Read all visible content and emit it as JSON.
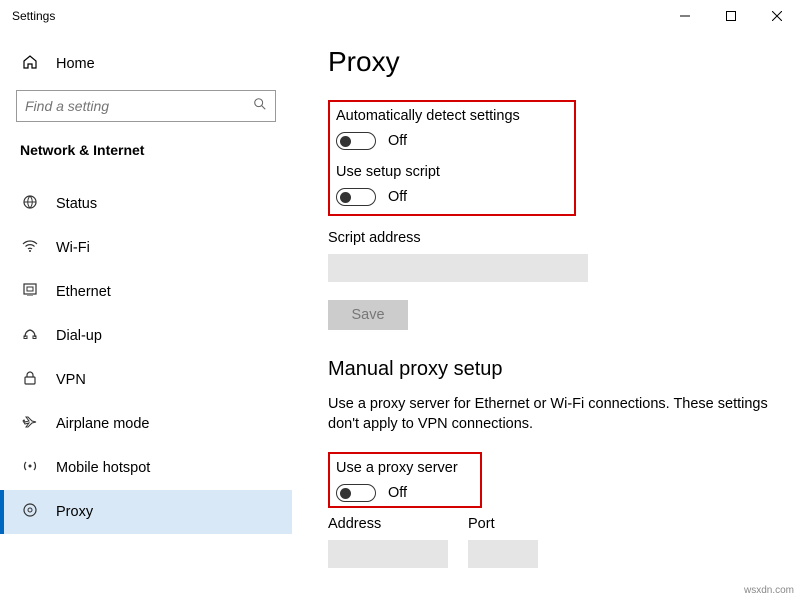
{
  "titlebar": {
    "title": "Settings"
  },
  "sidebar": {
    "home": "Home",
    "search_placeholder": "Find a setting",
    "category": "Network & Internet",
    "items": [
      {
        "label": "Status"
      },
      {
        "label": "Wi-Fi"
      },
      {
        "label": "Ethernet"
      },
      {
        "label": "Dial-up"
      },
      {
        "label": "VPN"
      },
      {
        "label": "Airplane mode"
      },
      {
        "label": "Mobile hotspot"
      },
      {
        "label": "Proxy"
      }
    ]
  },
  "main": {
    "title": "Proxy",
    "auto_detect_label": "Automatically detect settings",
    "auto_detect_state": "Off",
    "setup_script_label": "Use setup script",
    "setup_script_state": "Off",
    "script_address_label": "Script address",
    "save": "Save",
    "manual_title": "Manual proxy setup",
    "manual_desc": "Use a proxy server for Ethernet or Wi-Fi connections. These settings don't apply to VPN connections.",
    "use_proxy_label": "Use a proxy server",
    "use_proxy_state": "Off",
    "address_label": "Address",
    "port_label": "Port"
  },
  "watermark": "wsxdn.com"
}
